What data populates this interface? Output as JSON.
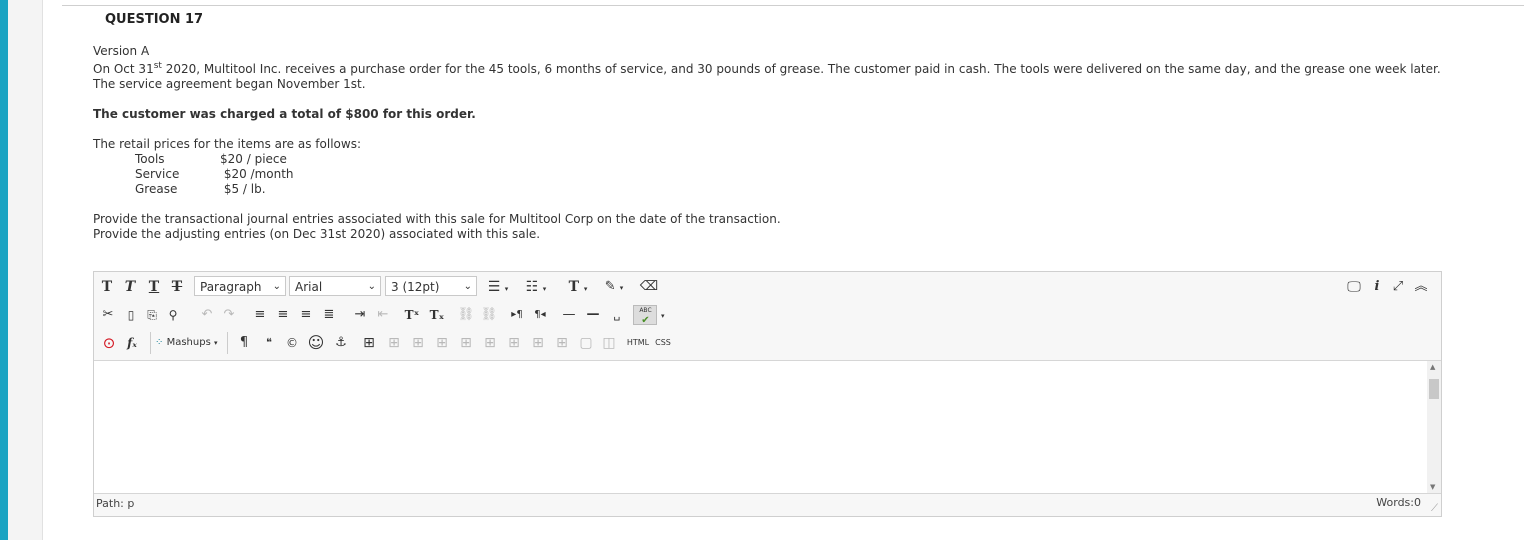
{
  "question": {
    "title": "QUESTION 17",
    "version": "Version A",
    "para1_pre": "On Oct 31",
    "para1_sup": "st",
    "para1_post": " 2020, Multitool Inc. receives a purchase order for the 45 tools, 6 months of service, and 30 pounds of grease. The customer paid in cash. The tools were delivered on the same day, and the grease one week later. The service agreement began November 1st.",
    "bold_line": "The customer was charged a total of $800 for this order.",
    "prices_intro": "The retail prices for the items are as follows:",
    "prices": [
      {
        "name": "Tools",
        "price": "$20 / piece"
      },
      {
        "name": "Service",
        "price": " $20 /month"
      },
      {
        "name": "Grease",
        "price": " $5 / lb."
      }
    ],
    "provide1": "Provide the transactional journal entries associated with this sale for Multitool Corp on the date of the transaction.",
    "provide2": "Provide the adjusting entries (on Dec 31st 2020) associated with this sale."
  },
  "editor": {
    "format_select": "Paragraph",
    "font_select": "Arial",
    "size_select": "3 (12pt)",
    "mashups_label": "Mashups",
    "html_label": "HTML",
    "css_label": "CSS",
    "spell_label": "ABC",
    "path_label": "Path: p",
    "words_label": "Words:0"
  },
  "icons": {
    "bold": "T",
    "italic": "T",
    "underline": "T",
    "strike": "T",
    "cut": "✂",
    "copy": "🗋",
    "paste": "📋",
    "find": "🔍",
    "undo": "↶",
    "redo": "↷",
    "superscript": "Tˣ",
    "subscript": "Tₓ",
    "pilcrow": "¶",
    "quote": "❝",
    "copyright": "©",
    "smiley": "☺",
    "anchor": "⚓",
    "preview": "🖵",
    "info": "i",
    "fullscreen": "⤢",
    "collapse": "︽"
  }
}
